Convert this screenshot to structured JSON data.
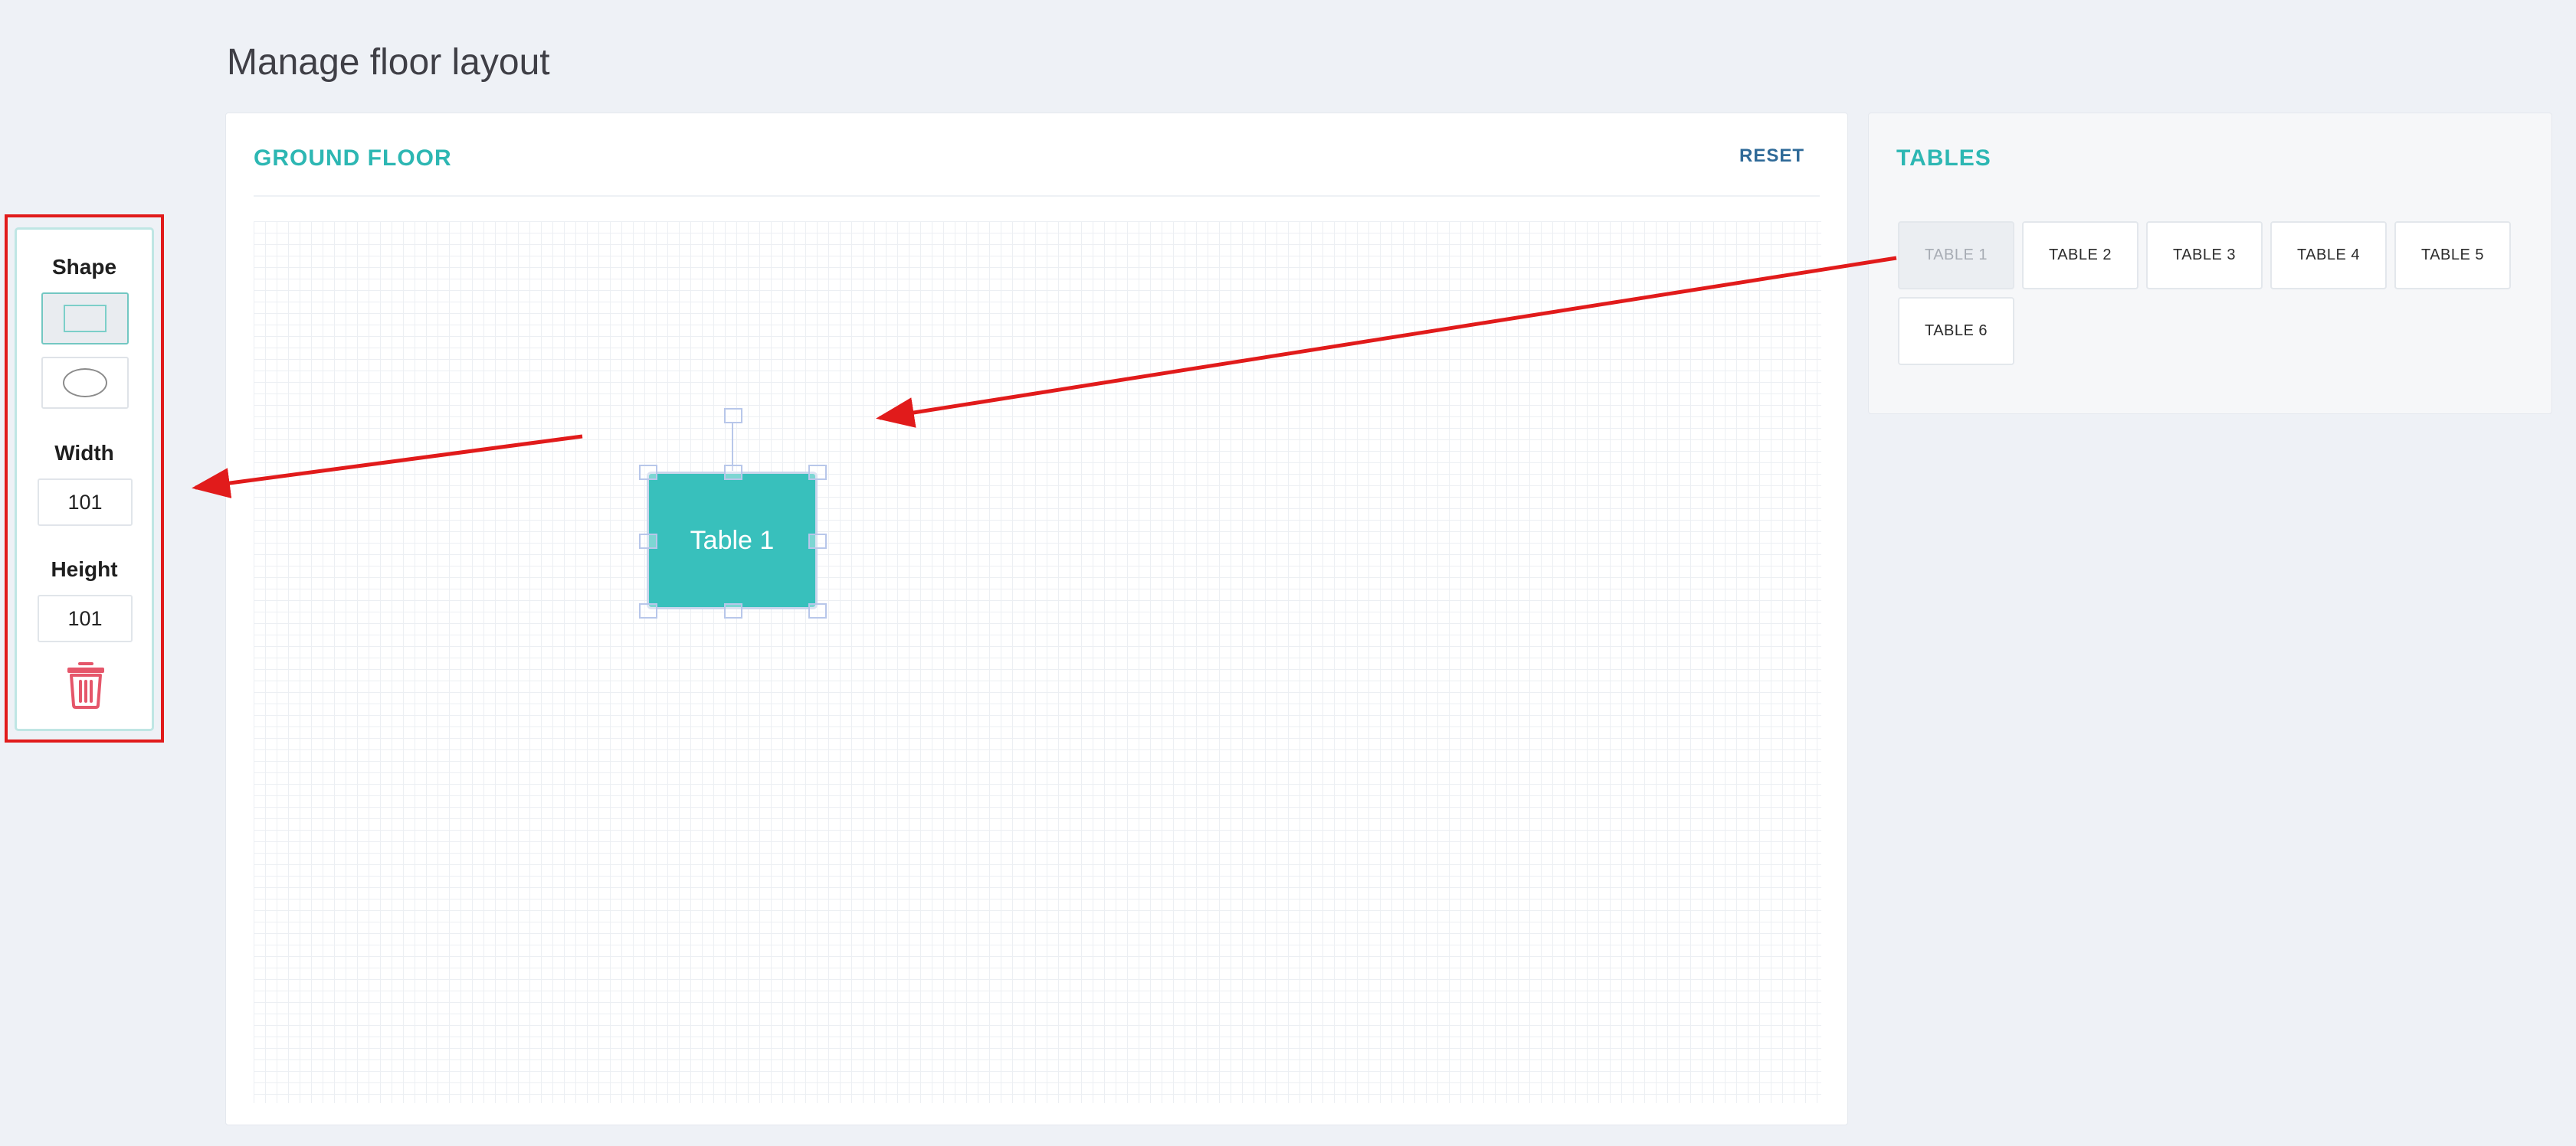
{
  "page": {
    "title": "Manage floor layout"
  },
  "floor": {
    "title": "GROUND FLOOR",
    "reset_label": "RESET",
    "selected_table": {
      "label": "Table 1"
    }
  },
  "tables_panel": {
    "title": "TABLES",
    "items": [
      {
        "label": "TABLE 1",
        "placed": true
      },
      {
        "label": "TABLE 2",
        "placed": false
      },
      {
        "label": "TABLE 3",
        "placed": false
      },
      {
        "label": "TABLE 4",
        "placed": false
      },
      {
        "label": "TABLE 5",
        "placed": false
      },
      {
        "label": "TABLE 6",
        "placed": false
      }
    ]
  },
  "properties": {
    "shape_label": "Shape",
    "shape_options": [
      {
        "name": "rectangle",
        "selected": true
      },
      {
        "name": "ellipse",
        "selected": false
      }
    ],
    "width_label": "Width",
    "width_value": "101",
    "height_label": "Height",
    "height_value": "101",
    "delete_icon": "trash-icon"
  },
  "colors": {
    "accent": "#2db7b3",
    "table_fill": "#38c0bc",
    "annotation_red": "#e11b1b",
    "delete_red": "#e5566a",
    "reset_link": "#2f6a98"
  }
}
